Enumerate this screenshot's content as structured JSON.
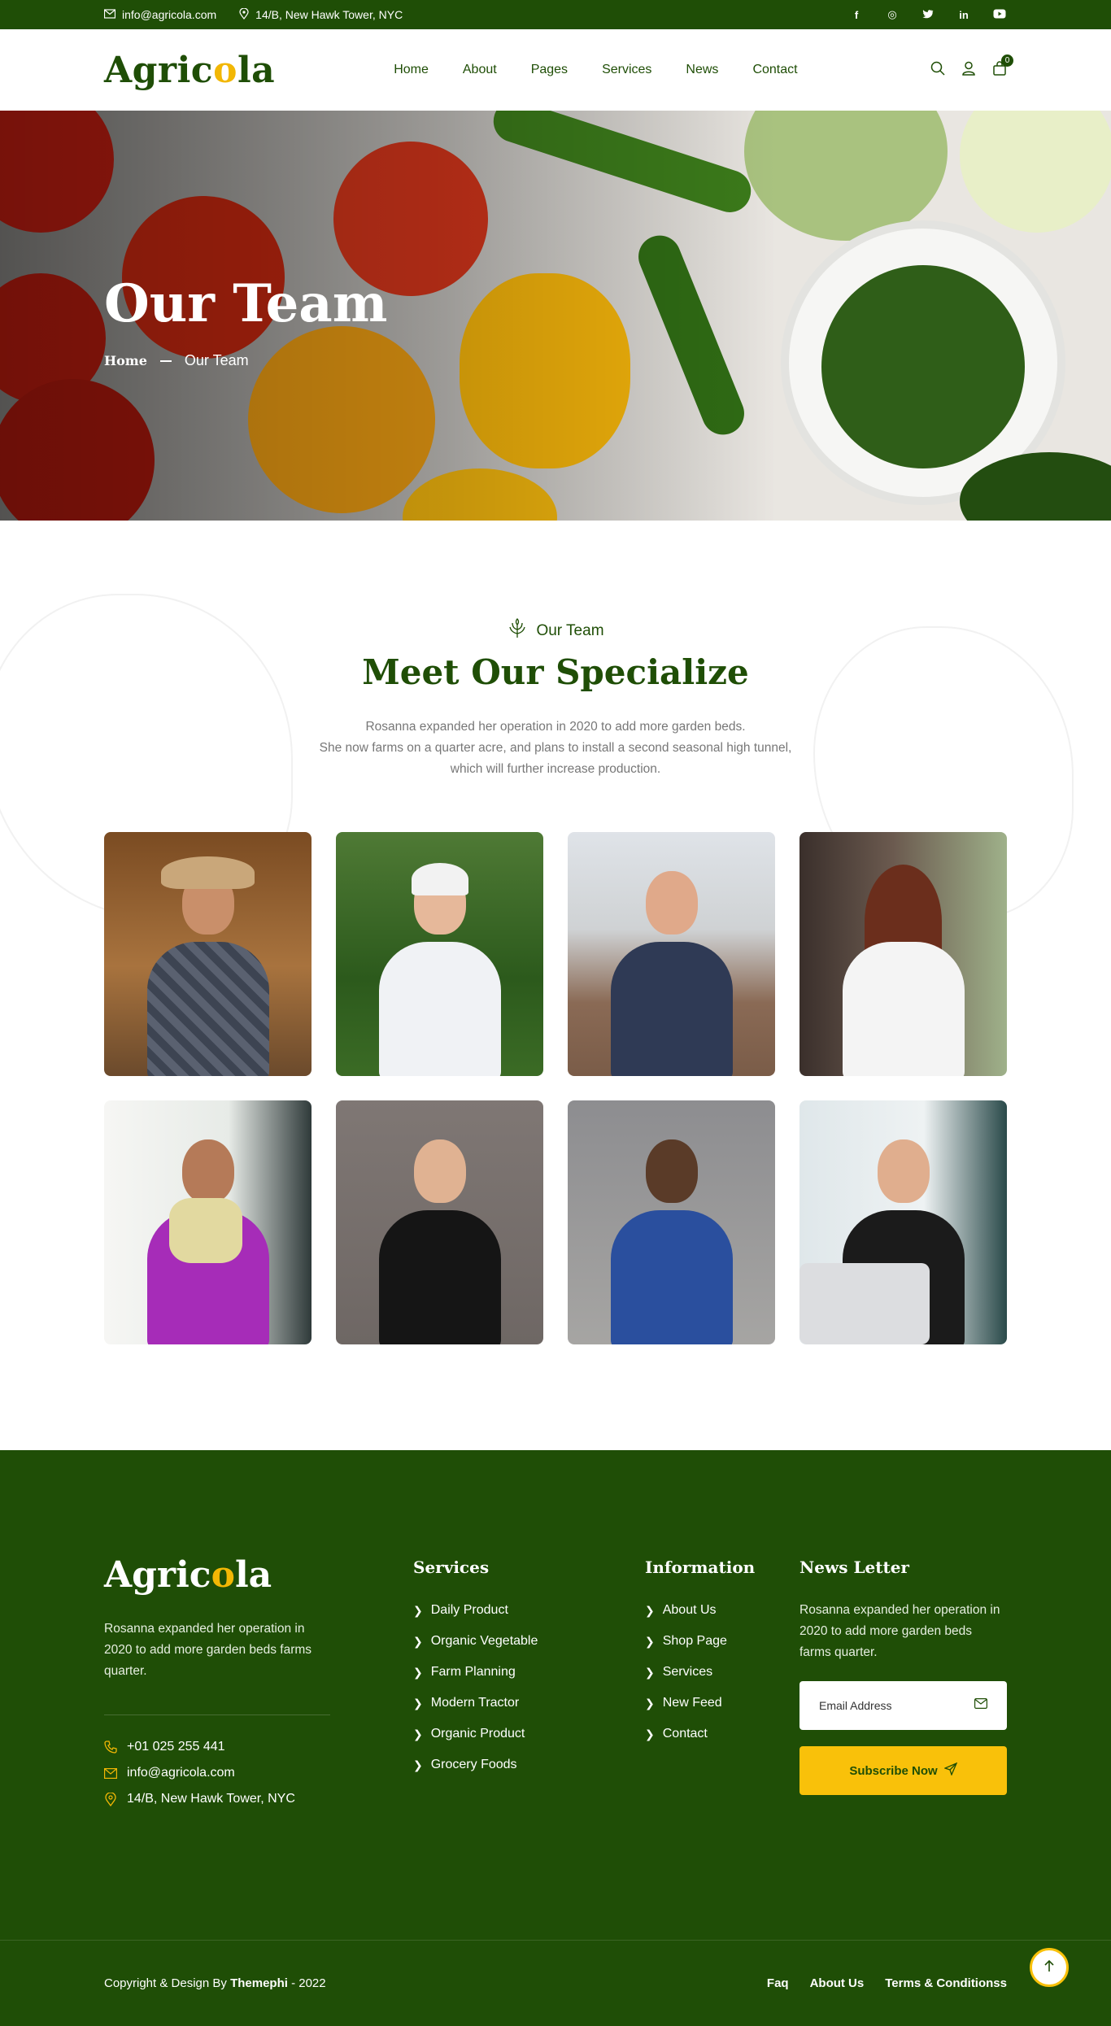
{
  "topbar": {
    "email": "info@agricola.com",
    "address": "14/B, New Hawk Tower, NYC",
    "social": [
      {
        "icon": "facebook-icon",
        "glyph": "f"
      },
      {
        "icon": "instagram-icon",
        "glyph": "◎"
      },
      {
        "icon": "twitter-icon",
        "glyph": "🐦"
      },
      {
        "icon": "linkedin-icon",
        "glyph": "in"
      },
      {
        "icon": "youtube-icon",
        "glyph": "▶"
      }
    ]
  },
  "header": {
    "logo_prefix": "Agric",
    "logo_o": "o",
    "logo_suffix": "la",
    "nav": [
      "Home",
      "About",
      "Pages",
      "Services",
      "News",
      "Contact"
    ],
    "cart_count": "0"
  },
  "hero": {
    "title": "Our Team",
    "breadcrumb_home": "Home",
    "breadcrumb_current": "Our Team"
  },
  "team": {
    "subtitle": "Our Team",
    "title": "Meet Our Specialize",
    "desc_line1": "Rosanna expanded her operation in 2020 to add more garden beds.",
    "desc_line2": "She now farms on a quarter acre, and plans to install a second seasonal high tunnel,",
    "desc_line3": "which will further increase production."
  },
  "footer": {
    "logo_prefix": "Agric",
    "logo_o": "o",
    "logo_suffix": "la",
    "about": "Rosanna expanded her operation in 2020 to add more garden beds farms quarter.",
    "phone": "+01 025 255 441",
    "email": "info@agricola.com",
    "address": "14/B, New Hawk Tower, NYC",
    "services_title": "Services",
    "services": [
      "Daily Product",
      "Organic Vegetable",
      "Farm Planning",
      "Modern Tractor",
      "Organic Product",
      "Grocery Foods"
    ],
    "info_title": "Information",
    "info": [
      "About Us",
      "Shop Page",
      "Services",
      "New Feed",
      "Contact"
    ],
    "news_title": "News Letter",
    "news_text": "Rosanna expanded her operation in 2020 to add more garden beds farms quarter.",
    "email_placeholder": "Email Address",
    "subscribe_label": "Subscribe Now",
    "copyright_prefix": "Copyright & Design By ",
    "copyright_brand": "Themephi",
    "copyright_suffix": " - 2022",
    "bottom_links": [
      "Faq",
      "About Us",
      "Terms & Conditionss"
    ]
  },
  "colors": {
    "brand_green": "#1f4e06",
    "accent_yellow": "#f9c10a"
  }
}
